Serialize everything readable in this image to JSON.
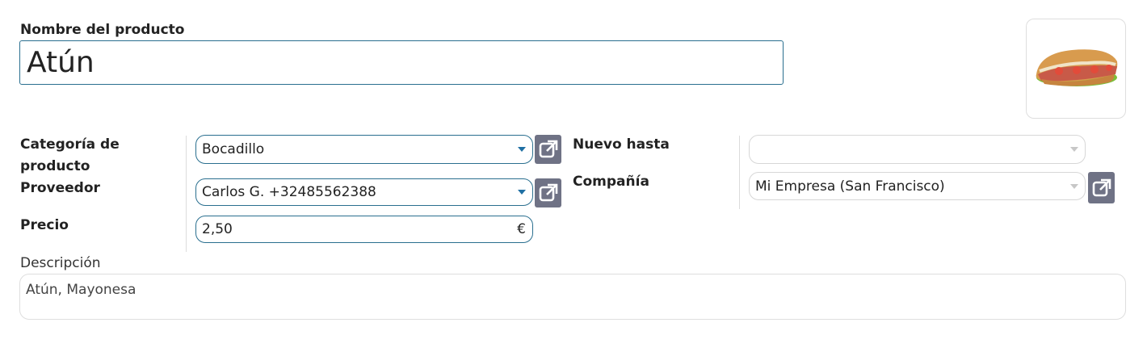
{
  "product": {
    "name_label": "Nombre del producto",
    "name_value": "Atún",
    "photo_alt": "sandwich-photo"
  },
  "left_fields": {
    "category_label_line1": "Categoría de",
    "category_label_line2": "producto",
    "category_value": "Bocadillo",
    "supplier_label": "Proveedor",
    "supplier_value": "Carlos G. +32485562388",
    "price_label": "Precio",
    "price_value": "2,50",
    "currency": "€"
  },
  "right_fields": {
    "new_until_label": "Nuevo hasta",
    "new_until_value": "",
    "company_label": "Compañía",
    "company_value": "Mi Empresa (San Francisco)"
  },
  "description": {
    "label": "Descripción",
    "value": "Atún, Mayonesa"
  },
  "colors": {
    "accent_border": "#2a6f8f",
    "caret": "#1f6fa3",
    "external_button": "#6f7285"
  }
}
